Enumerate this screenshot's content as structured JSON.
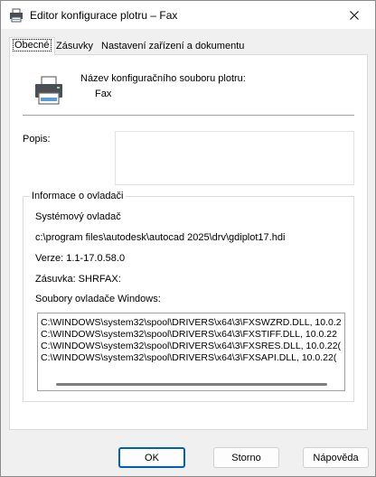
{
  "window": {
    "title": "Editor konfigurace plotru – Fax"
  },
  "tabs": [
    {
      "label": "Obecné",
      "active": true
    },
    {
      "label": "Zásuvky",
      "active": false
    },
    {
      "label": "Nastavení zařízení a dokumentu",
      "active": false
    }
  ],
  "general": {
    "config_label": "Název konfiguračního souboru plotru:",
    "config_value": "Fax",
    "description_label": "Popis:",
    "description_value": ""
  },
  "driver_info": {
    "group_title": "Informace o ovladači",
    "driver_type": "Systémový ovladač",
    "driver_path": "c:\\program files\\autodesk\\autocad 2025\\drv\\gdiplot17.hdi",
    "version": "Verze: 1.1-17.0.58.0",
    "port": "Zásuvka: SHRFAX:",
    "files_label": "Soubory ovladače Windows:",
    "files": [
      "C:\\WINDOWS\\system32\\spool\\DRIVERS\\x64\\3\\FXSWZRD.DLL, 10.0.2",
      "C:\\WINDOWS\\system32\\spool\\DRIVERS\\x64\\3\\FXSTIFF.DLL, 10.0.22",
      "C:\\WINDOWS\\system32\\spool\\DRIVERS\\x64\\3\\FXSRES.DLL, 10.0.22(",
      "C:\\WINDOWS\\system32\\spool\\DRIVERS\\x64\\3\\FXSAPI.DLL, 10.0.22("
    ]
  },
  "buttons": {
    "ok": "OK",
    "cancel": "Storno",
    "help": "Nápověda"
  },
  "colors": {
    "accent": "#005fb8",
    "printer_body": "#4a4f55",
    "printer_tray": "#5b9bd5"
  },
  "icons": {
    "title": "printer-icon",
    "close": "close-icon",
    "printer": "printer-icon"
  }
}
